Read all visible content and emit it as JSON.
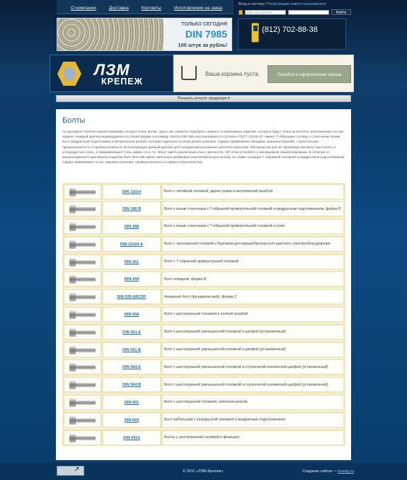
{
  "nav": [
    "О компании",
    "Доставка",
    "Контакты",
    "Изготовление на заказ"
  ],
  "login": {
    "text": "Вход в систему / ",
    "register": "Регистрация нового пользователя",
    "username_placeholder": "Имя пользователя",
    "button": "Войти"
  },
  "banner": {
    "line1": "ТОЛЬКО СЕГОДНЯ",
    "line2": "DIN 7985",
    "line3": "100 штук за рубль!"
  },
  "phone": "(812) 702-88-38",
  "logo": {
    "line1": "ЛЗМ",
    "line2": "КРЕПЕЖ"
  },
  "cart": {
    "status": "Ваша корзина пуста",
    "checkout": "Перейти к оформлению заказа"
  },
  "catalog_toggle": "Показать каталог продукции  ▾",
  "page": {
    "title": "Болты",
    "intro": "Ассортимент болтов нашей компании сегодня очень велик. Здесь вы сможете подобрать именно те крепежные изделия, которые будут точно выполнять возложенные на них задачи. Каждый крепеж индивидуален по своей форме и размеру. Болты DIN 186 изготавливаются согласно ГОСТ 13152-67, имеют Т-образную головку к станочным пазам. Есть квадратный подголовник и метрическая резьба, которая нарезана по всей длине шпильки. Сфера применения обширна: машиностроение, строительная промышленность и промышленность использующая данный крепеж для соединения различных деталей агрегатов. Материалом для их производства могут выступать и углеродистая сталь, и нержавеющая сталь марки А4 и А1. Могут иметь различный класс прочности. Об этом уточняйте у менеджеров нашей компании. В отличие от вышеназванного крепежного изделия болт DIN 188 имеет неполную дюймовую или метрическую резьбу, но также оснащен Т-образной головкой и квадратным подголовником. Сфера применения та же: машиностроение, промышленность и сфера строительства."
  },
  "products": [
    {
      "code": "DIN 11014",
      "desc": "Болт с потайной головкой, двумя усами и метрической резьбой"
    },
    {
      "code": "DIN 186 B",
      "desc": "Болт к пазам станочным с Т-образной прямоугольной головкой и квадратным подголовником, форма В"
    },
    {
      "code": "DIN 188",
      "desc": "Болт к пазам станочным с Т-образной прямоугольной головкой и усом"
    },
    {
      "code": "DIN 22424 A",
      "desc": "Болт с трехгранной головкой и буртиком для взрывобезопасного шахтного электрооборудования"
    },
    {
      "code": "DIN 261",
      "desc": "Болт с Т-образной прямоугольной головкой"
    },
    {
      "code": "DIN 444",
      "desc": "Болт откидной, форма В"
    },
    {
      "code": "DIN 529 ABCDF",
      "desc": "Анкерный болт (фундаментный), форма С"
    },
    {
      "code": "DIN 558",
      "desc": "Болт с шестигранной головкой и полной резьбой"
    },
    {
      "code": "DIN 561 A",
      "desc": "Болт с шестигранной уменьшенной головкой и цапфой (установочный)"
    },
    {
      "code": "DIN 561 B",
      "desc": "Болт с шестигранной уменьшенной головкой и цапфой (установочный)"
    },
    {
      "code": "DIN 564 A",
      "desc": "Болт с шестигранной уменьшенной головкой и ступенчатой конической цапфой (установочный)"
    },
    {
      "code": "DIN 564 B",
      "desc": "Болт с шестигранной уменьшенной головкой и ступенчатой конической цапфой (установочный)"
    },
    {
      "code": "DIN 601",
      "desc": "Болт с шестигранной головкой, неполная резьба"
    },
    {
      "code": "DIN 603",
      "desc": "Болт мебельный с полукруглой головкой и квадратным подголовником"
    },
    {
      "code": "DIN 6921",
      "desc": "Болты с шестигранной головкой и фланцем"
    }
  ],
  "footer": {
    "copyright": "© 2011 «ЛЗМ-Крепеж»",
    "credit_label": "Создание сайтов — ",
    "credit_link": "koreloy.ru"
  }
}
